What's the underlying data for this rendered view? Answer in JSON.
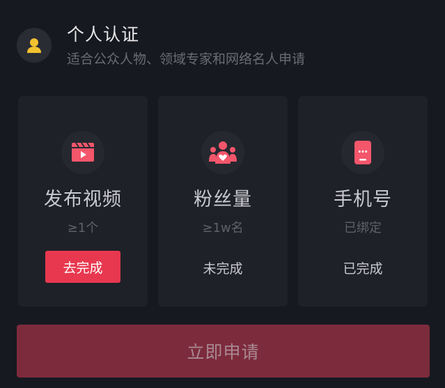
{
  "header": {
    "title": "个人认证",
    "subtitle": "适合公众人物、领域专家和网络名人申请",
    "avatar_icon": "person-icon"
  },
  "colors": {
    "accent": "#e8384f",
    "background": "#171920",
    "card": "#1f2128",
    "submit_disabled": "#7c2b3c"
  },
  "cards": [
    {
      "icon": "video-clapper-icon",
      "title": "发布视频",
      "requirement": "≥1个",
      "action_label": "去完成"
    },
    {
      "icon": "fans-icon",
      "title": "粉丝量",
      "requirement": "≥1w名",
      "status": "未完成"
    },
    {
      "icon": "phone-icon",
      "title": "手机号",
      "requirement": "已绑定",
      "status": "已完成"
    }
  ],
  "submit": {
    "label": "立即申请"
  }
}
